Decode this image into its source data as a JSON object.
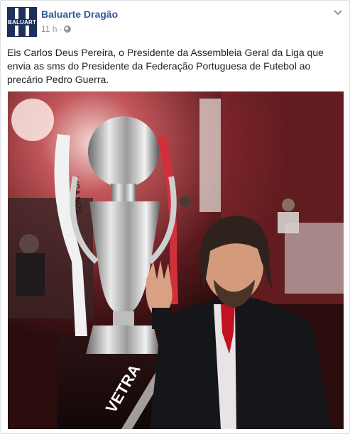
{
  "post": {
    "author": "Baluarte Dragão",
    "avatar_text": "BALUARTE",
    "time": "11 h",
    "separator": "·",
    "privacy_icon": "globe-icon",
    "text": "Eis Carlos Deus Pereira, o Presidente da Assembleia Geral da Liga que envia as sms do Presidente da Federação Portuguesa de Futebol ao precário Pedro Guerra.",
    "menu_icon": "chevron-down-icon"
  },
  "photo": {
    "ribbon_text": "LIGA NOS",
    "banner_text": "VETRA"
  },
  "colors": {
    "link": "#365899",
    "meta": "#90949c",
    "text": "#1d2129",
    "avatar_bg": "#1d2f5c"
  }
}
